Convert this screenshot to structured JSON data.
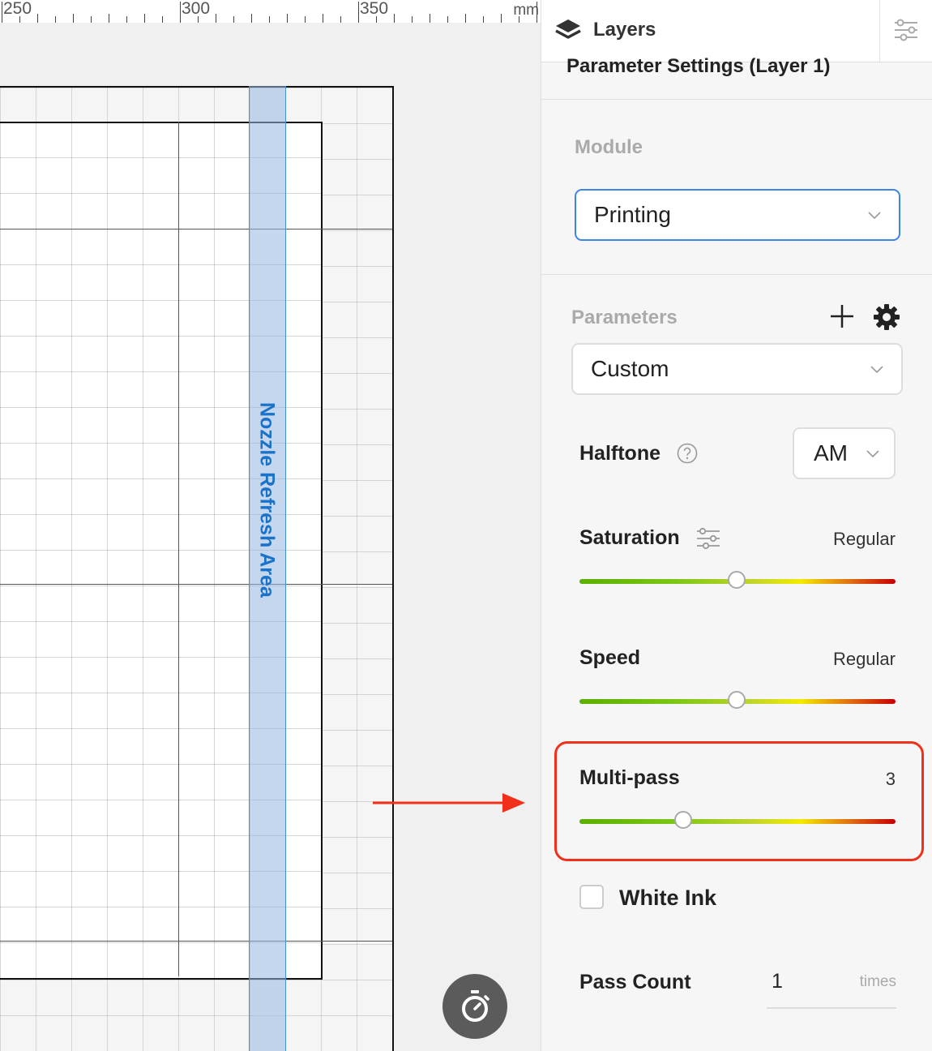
{
  "ruler": {
    "labels": [
      "250",
      "300",
      "350"
    ],
    "unit": "mm"
  },
  "canvas": {
    "nozzle_area_label": "Nozzle Refresh Area",
    "timer_icon": "stopwatch-icon"
  },
  "panel": {
    "tab_label": "Layers",
    "tab_icon": "layers-icon",
    "settings_icon": "sliders-icon",
    "section_title": "Parameter Settings (Layer 1)",
    "module": {
      "label": "Module",
      "value": "Printing"
    },
    "parameters": {
      "label": "Parameters",
      "value": "Custom",
      "add_icon": "plus-icon",
      "gear_icon": "gear-icon"
    },
    "halftone": {
      "label": "Halftone",
      "value": "AM",
      "help_icon": "question-circle-icon"
    },
    "saturation": {
      "label": "Saturation",
      "value": "Regular",
      "level": 0.5,
      "icon": "sliders-icon"
    },
    "speed": {
      "label": "Speed",
      "value": "Regular",
      "level": 0.5
    },
    "multipass": {
      "label": "Multi-pass",
      "value": "3",
      "level": 0.33
    },
    "white_ink": {
      "label": "White Ink",
      "checked": false
    },
    "pass_count": {
      "label": "Pass Count",
      "value": "1",
      "unit": "times"
    },
    "highlight_color": "#f2301a",
    "accent_color": "#1a73c8"
  }
}
